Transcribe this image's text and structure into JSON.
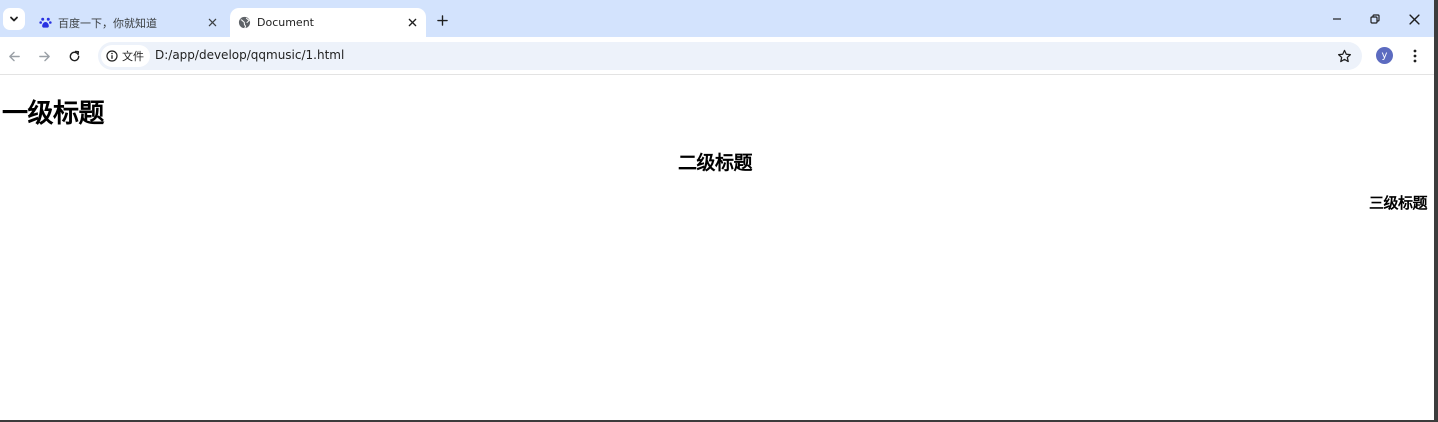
{
  "tabs": [
    {
      "title": "百度一下，你就知道",
      "icon": "baidu-paw-icon",
      "active": false
    },
    {
      "title": "Document",
      "icon": "globe-icon",
      "active": true
    }
  ],
  "omnibox": {
    "security_chip_label": "文件",
    "url": "D:/app/develop/qqmusic/1.html"
  },
  "profile": {
    "avatar_letter": "y",
    "color": "#5c6bc0"
  },
  "colors": {
    "tabstrip": "#d3e3fd",
    "omnibox": "#edf2fa"
  },
  "page": {
    "h1": "一级标题",
    "h2": "二级标题",
    "h3": "三级标题"
  }
}
